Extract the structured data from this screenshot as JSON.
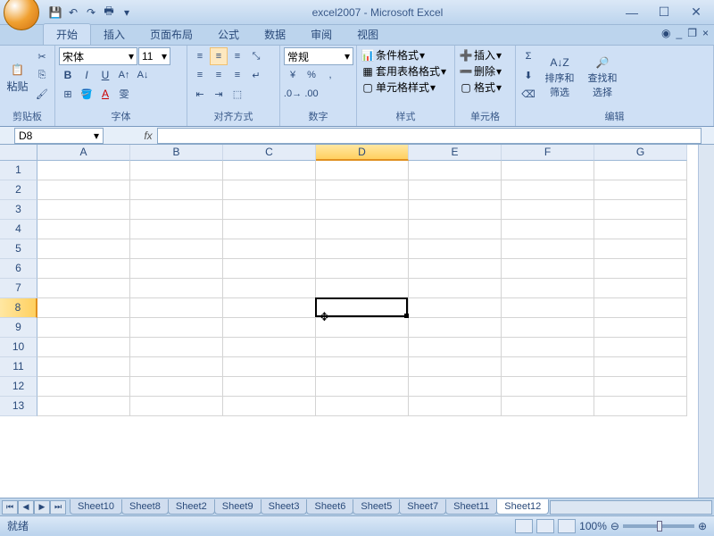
{
  "title": "excel2007 - Microsoft Excel",
  "tabs": {
    "home": "开始",
    "insert": "插入",
    "layout": "页面布局",
    "formula": "公式",
    "data": "数据",
    "review": "审阅",
    "view": "视图"
  },
  "clipboard": {
    "paste": "粘贴",
    "label": "剪贴板"
  },
  "font": {
    "name": "宋体",
    "size": "11",
    "label": "字体"
  },
  "align": {
    "label": "对齐方式"
  },
  "number": {
    "format": "常规",
    "label": "数字"
  },
  "styles": {
    "cond": "条件格式",
    "table": "套用表格格式",
    "cell": "单元格样式",
    "label": "样式"
  },
  "cells": {
    "insert": "插入",
    "delete": "删除",
    "format": "格式",
    "label": "单元格"
  },
  "editing": {
    "sort": "排序和\n筛选",
    "find": "查找和\n选择",
    "label": "编辑"
  },
  "namebox": "D8",
  "cols": [
    "A",
    "B",
    "C",
    "D",
    "E",
    "F",
    "G"
  ],
  "rows": [
    "1",
    "2",
    "3",
    "4",
    "5",
    "6",
    "7",
    "8",
    "9",
    "10",
    "11",
    "12",
    "13"
  ],
  "sel_col": 3,
  "sel_row": 7,
  "sheets": [
    "Sheet10",
    "Sheet8",
    "Sheet2",
    "Sheet9",
    "Sheet3",
    "Sheet6",
    "Sheet5",
    "Sheet7",
    "Sheet11",
    "Sheet12"
  ],
  "active_sheet": 9,
  "status": "就绪",
  "zoom": "100%"
}
